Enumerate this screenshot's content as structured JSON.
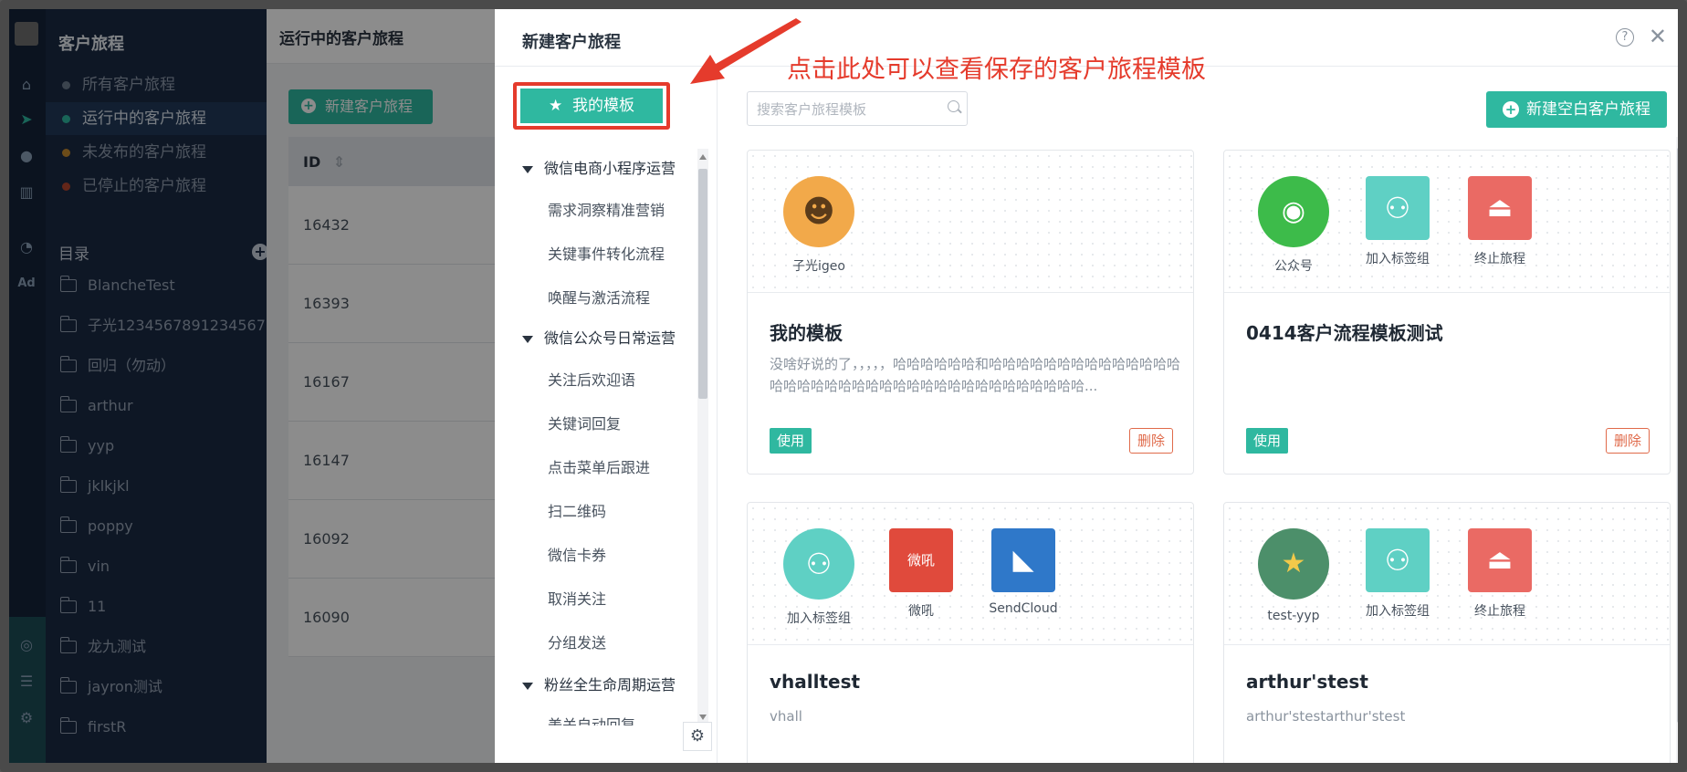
{
  "app": {
    "title": "客户旅程"
  },
  "sidebar": {
    "items": [
      {
        "label": "所有客户旅程",
        "color": "#6b7a8c"
      },
      {
        "label": "运行中的客户旅程",
        "color": "#2fb8a0"
      },
      {
        "label": "未发布的客户旅程",
        "color": "#c58a2e"
      },
      {
        "label": "已停止的客户旅程",
        "color": "#b5462e"
      }
    ],
    "directory_label": "目录",
    "folders": [
      "BlancheTest",
      "子光1234567891234567···",
      "回归（勿动）",
      "arthur",
      "yyp",
      "jklkjkl",
      "poppy",
      "vin",
      "11",
      "龙九测试",
      "jayron测试",
      "firstR"
    ]
  },
  "rail": {
    "icons": [
      "home-icon",
      "paper-plane-icon",
      "user-icon",
      "bar-chart-icon",
      "chat-icon",
      "ad-icon",
      "target-icon",
      "server-icon",
      "gear-icon"
    ],
    "ad_label": "Ad"
  },
  "main": {
    "header": "运行中的客户旅程",
    "new_button": "新建客户旅程",
    "id_header": "ID",
    "sort_icon": "⇕",
    "rows": [
      "16432",
      "16393",
      "16167",
      "16147",
      "16092",
      "16090"
    ]
  },
  "modal": {
    "title": "新建客户旅程",
    "help": "?",
    "close": "✕",
    "my_templates_label": "我的模板",
    "search_placeholder": "搜索客户旅程模板",
    "new_blank_label": "新建空白客户旅程",
    "tree": [
      {
        "group": "微信电商小程序运营",
        "items": [
          "需求洞察精准营销",
          "关键事件转化流程",
          "唤醒与激活流程"
        ]
      },
      {
        "group": "微信公众号日常运营",
        "items": [
          "关注后欢迎语",
          "关键词回复",
          "点击菜单后跟进",
          "扫二维码",
          "微信卡券",
          "取消关注",
          "分组发送"
        ]
      },
      {
        "group": "粉丝全生命周期运营",
        "items": [
          "美关自动回复"
        ]
      }
    ],
    "cards": [
      {
        "nodes": [
          {
            "label": "子光igeo",
            "icon": "avatar-icon",
            "shape": "round",
            "color": "#f2a94a",
            "glyph": "☻"
          }
        ],
        "name": "我的模板",
        "desc": "没啥好说的了，，，，，哈哈哈哈哈哈和哈哈哈哈哈哈哈哈哈哈哈哈哈哈哈哈哈哈哈哈哈哈哈哈哈哈哈哈哈哈哈哈哈哈哈哈哈...",
        "use": "使用",
        "delete": "删除"
      },
      {
        "nodes": [
          {
            "label": "公众号",
            "icon": "wechat-icon",
            "shape": "round",
            "color": "#3dbb4a",
            "glyph": "◉"
          },
          {
            "label": "加入标签组",
            "icon": "add-user-icon",
            "shape": "square",
            "color": "#5fd0c4",
            "glyph": "⚇"
          },
          {
            "label": "终止旅程",
            "icon": "stop-icon",
            "shape": "square",
            "color": "#ea6a64",
            "glyph": "⏏"
          }
        ],
        "name": "0414客户流程模板测试",
        "desc": "",
        "use": "使用",
        "delete": "删除"
      },
      {
        "nodes": [
          {
            "label": "加入标签组",
            "icon": "add-user-icon",
            "shape": "round",
            "color": "#5fd0c4",
            "glyph": "⚇"
          },
          {
            "label": "微吼",
            "icon": "vhall-icon",
            "shape": "square",
            "color": "#e04a3c",
            "glyph": "微吼"
          },
          {
            "label": "SendCloud",
            "icon": "sendcloud-icon",
            "shape": "square",
            "color": "#2f78c9",
            "glyph": "◣"
          }
        ],
        "name": "vhalltest",
        "desc": "vhall",
        "use": "",
        "delete": ""
      },
      {
        "nodes": [
          {
            "label": "test-yyp",
            "icon": "star-avatar-icon",
            "shape": "round",
            "color": "#4c8f6a",
            "glyph": "★"
          },
          {
            "label": "加入标签组",
            "icon": "add-user-icon",
            "shape": "square",
            "color": "#5fd0c4",
            "glyph": "⚇"
          },
          {
            "label": "终止旅程",
            "icon": "stop-icon",
            "shape": "square",
            "color": "#ea6a64",
            "glyph": "⏏"
          }
        ],
        "name": "arthur'stest",
        "desc": "arthur'stestarthur'stest",
        "use": "",
        "delete": ""
      }
    ]
  },
  "annotation": {
    "text": "点击此处可以查看保存的客户旅程模板",
    "color": "#e53b2c"
  },
  "colors": {
    "accent": "#2fb8a0",
    "sidebar": "#1b2a44",
    "danger": "#e53b2c"
  }
}
